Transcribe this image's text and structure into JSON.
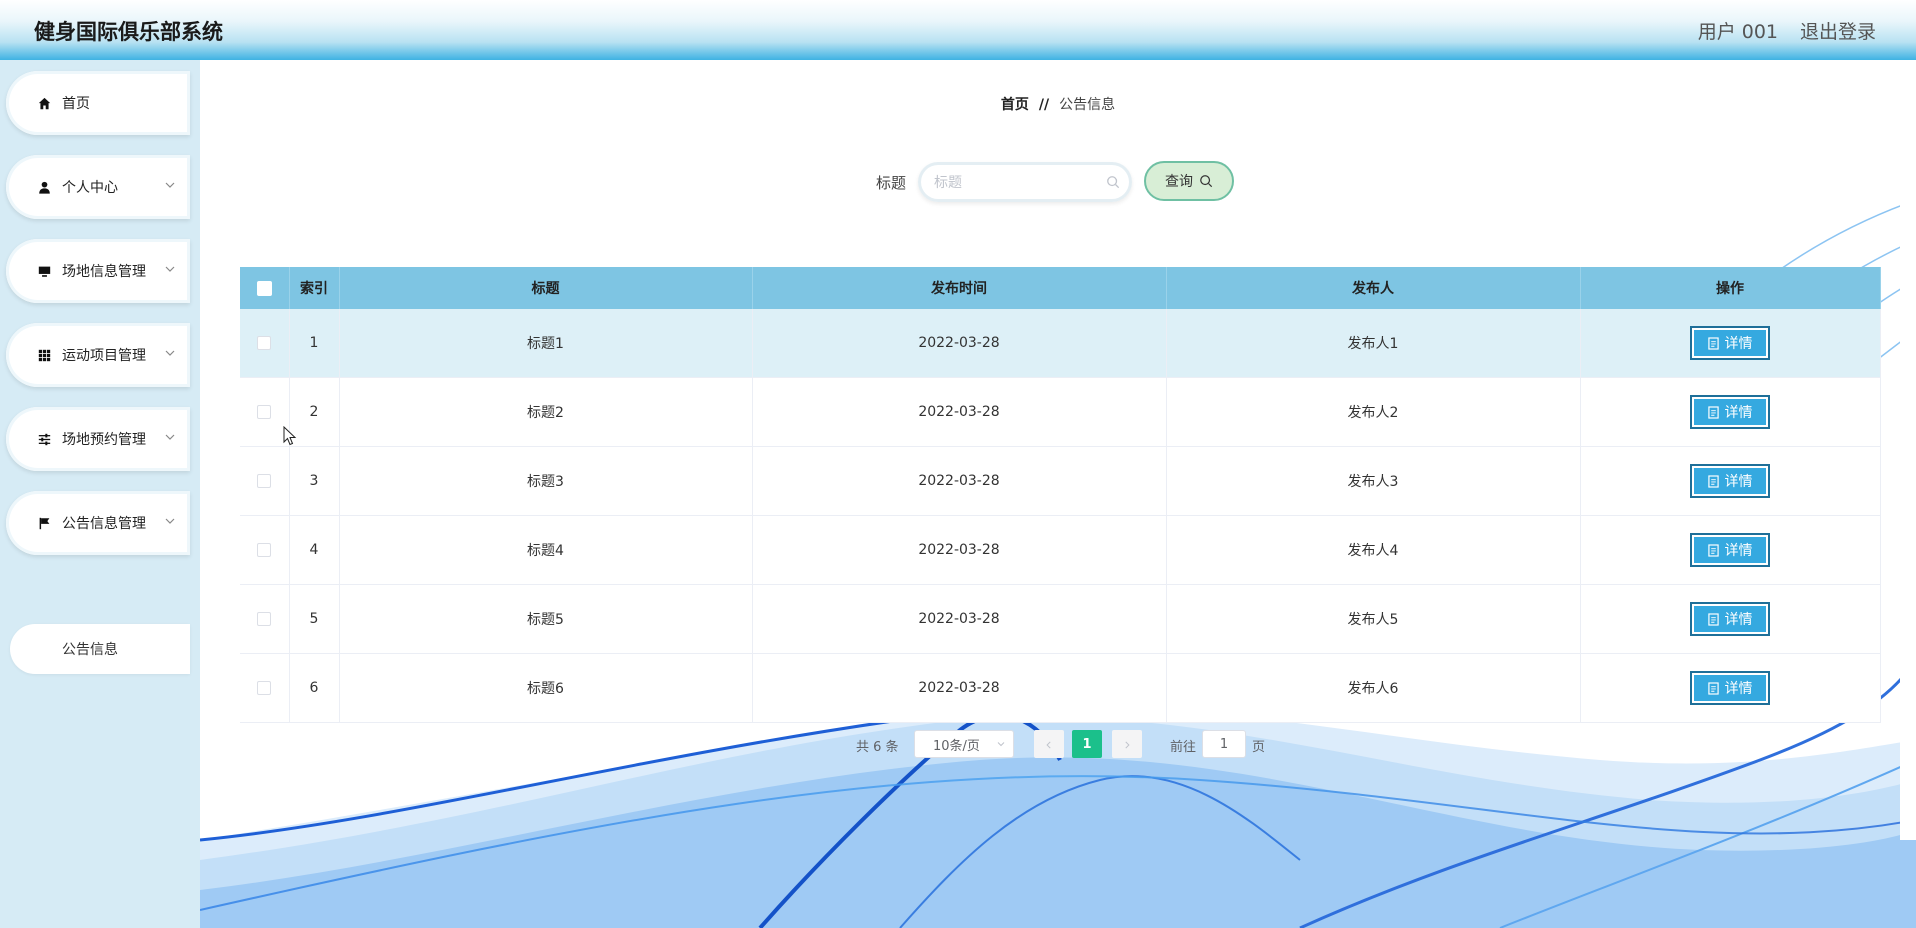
{
  "header": {
    "title": "健身国际俱乐部系统",
    "user": "用户 001",
    "logout": "退出登录"
  },
  "sidebar": {
    "items": [
      {
        "label": "首页",
        "icon": "home-icon",
        "has_arrow": false
      },
      {
        "label": "个人中心",
        "icon": "user-icon",
        "has_arrow": true
      },
      {
        "label": "场地信息管理",
        "icon": "monitor-icon",
        "has_arrow": true
      },
      {
        "label": "运动项目管理",
        "icon": "grid-icon",
        "has_arrow": true
      },
      {
        "label": "场地预约管理",
        "icon": "sliders-icon",
        "has_arrow": true
      },
      {
        "label": "公告信息管理",
        "icon": "flag-icon",
        "has_arrow": true
      }
    ],
    "submenu": {
      "label": "公告信息"
    }
  },
  "breadcrumb": {
    "home": "首页",
    "separator": "//",
    "current": "公告信息"
  },
  "search": {
    "label": "标题",
    "placeholder": "标题",
    "value": "",
    "button_label": "查询"
  },
  "table": {
    "columns": [
      "索引",
      "标题",
      "发布时间",
      "发布人",
      "操作"
    ],
    "rows": [
      {
        "index": "1",
        "title": "标题1",
        "time": "2022-03-28",
        "publisher": "发布人1",
        "action": "详情"
      },
      {
        "index": "2",
        "title": "标题2",
        "time": "2022-03-28",
        "publisher": "发布人2",
        "action": "详情"
      },
      {
        "index": "3",
        "title": "标题3",
        "time": "2022-03-28",
        "publisher": "发布人3",
        "action": "详情"
      },
      {
        "index": "4",
        "title": "标题4",
        "time": "2022-03-28",
        "publisher": "发布人4",
        "action": "详情"
      },
      {
        "index": "5",
        "title": "标题5",
        "time": "2022-03-28",
        "publisher": "发布人5",
        "action": "详情"
      },
      {
        "index": "6",
        "title": "标题6",
        "time": "2022-03-28",
        "publisher": "发布人6",
        "action": "详情"
      }
    ]
  },
  "pagination": {
    "total": "共 6 条",
    "page_size": "10条/页",
    "current_page": "1",
    "goto_label": "前往",
    "goto_value": "1",
    "goto_suffix": "页"
  },
  "colors": {
    "header_accent": "#3fb2e3",
    "table_header": "#7ec5e3",
    "active_page": "#1bc08b",
    "detail_button": "#35a9e0",
    "query_button": "#d8eed6"
  }
}
